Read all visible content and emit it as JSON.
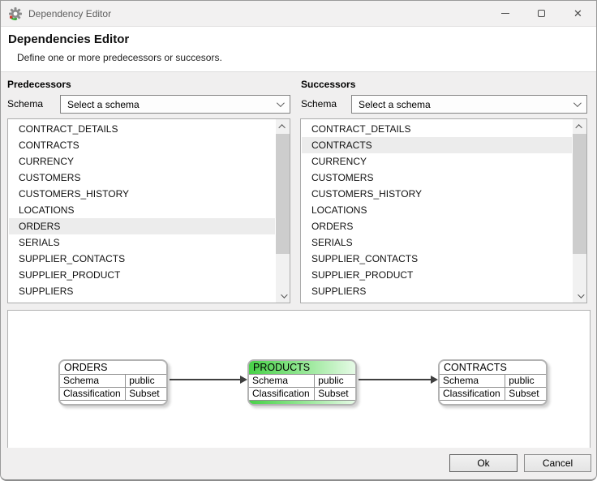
{
  "window": {
    "title": "Dependency Editor",
    "close_glyph": "✕"
  },
  "header": {
    "title": "Dependencies Editor",
    "subtitle": "Define one or more predecessors or succesors."
  },
  "predecessors": {
    "label": "Predecessors",
    "schema_label": "Schema",
    "schema_value": "Select a schema",
    "selected": "ORDERS",
    "items": [
      "CONTRACT_DETAILS",
      "CONTRACTS",
      "CURRENCY",
      "CUSTOMERS",
      "CUSTOMERS_HISTORY",
      "LOCATIONS",
      "ORDERS",
      "SERIALS",
      "SUPPLIER_CONTACTS",
      "SUPPLIER_PRODUCT",
      "SUPPLIERS"
    ]
  },
  "successors": {
    "label": "Successors",
    "schema_label": "Schema",
    "schema_value": "Select a schema",
    "selected": "CONTRACTS",
    "items": [
      "CONTRACT_DETAILS",
      "CONTRACTS",
      "CURRENCY",
      "CUSTOMERS",
      "CUSTOMERS_HISTORY",
      "LOCATIONS",
      "ORDERS",
      "SERIALS",
      "SUPPLIER_CONTACTS",
      "SUPPLIER_PRODUCT",
      "SUPPLIERS"
    ]
  },
  "diagram": {
    "nodes": [
      {
        "name": "ORDERS",
        "highlight": false,
        "rows": [
          {
            "label": "Schema",
            "value": "public"
          },
          {
            "label": "Classification",
            "value": "Subset"
          }
        ]
      },
      {
        "name": "PRODUCTS",
        "highlight": true,
        "rows": [
          {
            "label": "Schema",
            "value": "public"
          },
          {
            "label": "Classification",
            "value": "Subset"
          }
        ]
      },
      {
        "name": "CONTRACTS",
        "highlight": false,
        "rows": [
          {
            "label": "Schema",
            "value": "public"
          },
          {
            "label": "Classification",
            "value": "Subset"
          }
        ]
      }
    ]
  },
  "footer": {
    "ok_label": "Ok",
    "cancel_label": "Cancel"
  },
  "colors": {
    "highlight_green_start": "#47d147",
    "highlight_green_end": "#e6fae6",
    "selection_gray": "#ececec"
  }
}
